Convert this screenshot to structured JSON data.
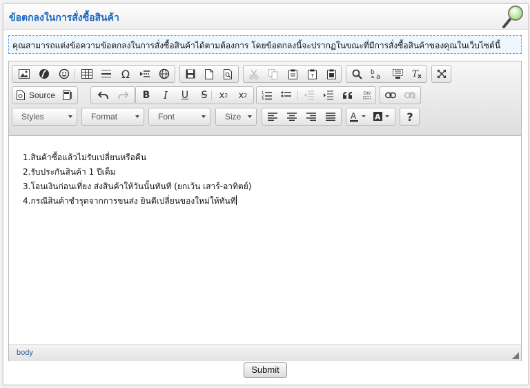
{
  "header": {
    "title": "ข้อตกลงในการสั่งซื้อสินค้า",
    "icon": "magnifier-icon"
  },
  "notice": {
    "text": "คุณสามารถแต่งข้อความข้อตกลงในการสั่งซื้อสินค้าได้ตามต้องการ โดยข้อตกลงนี้จะปรากฏในขณะที่มีการสั่งซื้อสินค้าของคุณในเว็บไซต์นี้"
  },
  "toolbar": {
    "source_label": "Source",
    "styles_label": "Styles",
    "format_label": "Format",
    "font_label": "Font",
    "size_label": "Size",
    "help_label": "?",
    "bold_label": "B",
    "italic_label": "I",
    "underline_label": "U",
    "strike_label": "S"
  },
  "content": {
    "lines": [
      "1.สินค้าซื้อแล้วไม่รับเปลี่ยนหรือคืน",
      "2.รับประกันสินค้า 1 ปีเต็ม",
      "3.โอนเงินก่อนเที่ยง ส่งสินค้าให้วันนั้นทันที (ยกเว้น เสาร์-อาทิตย์)",
      "4.กรณีสินค้าชำรุดจากการขนส่ง ยินดีเปลี่ยนของใหม่ให้ทันที"
    ]
  },
  "statusbar": {
    "path": "body"
  },
  "submit": {
    "label": "Submit"
  },
  "colors": {
    "title": "#1b66c0",
    "notice_border": "#5aa2e6",
    "notice_bg": "#eef7ff"
  }
}
